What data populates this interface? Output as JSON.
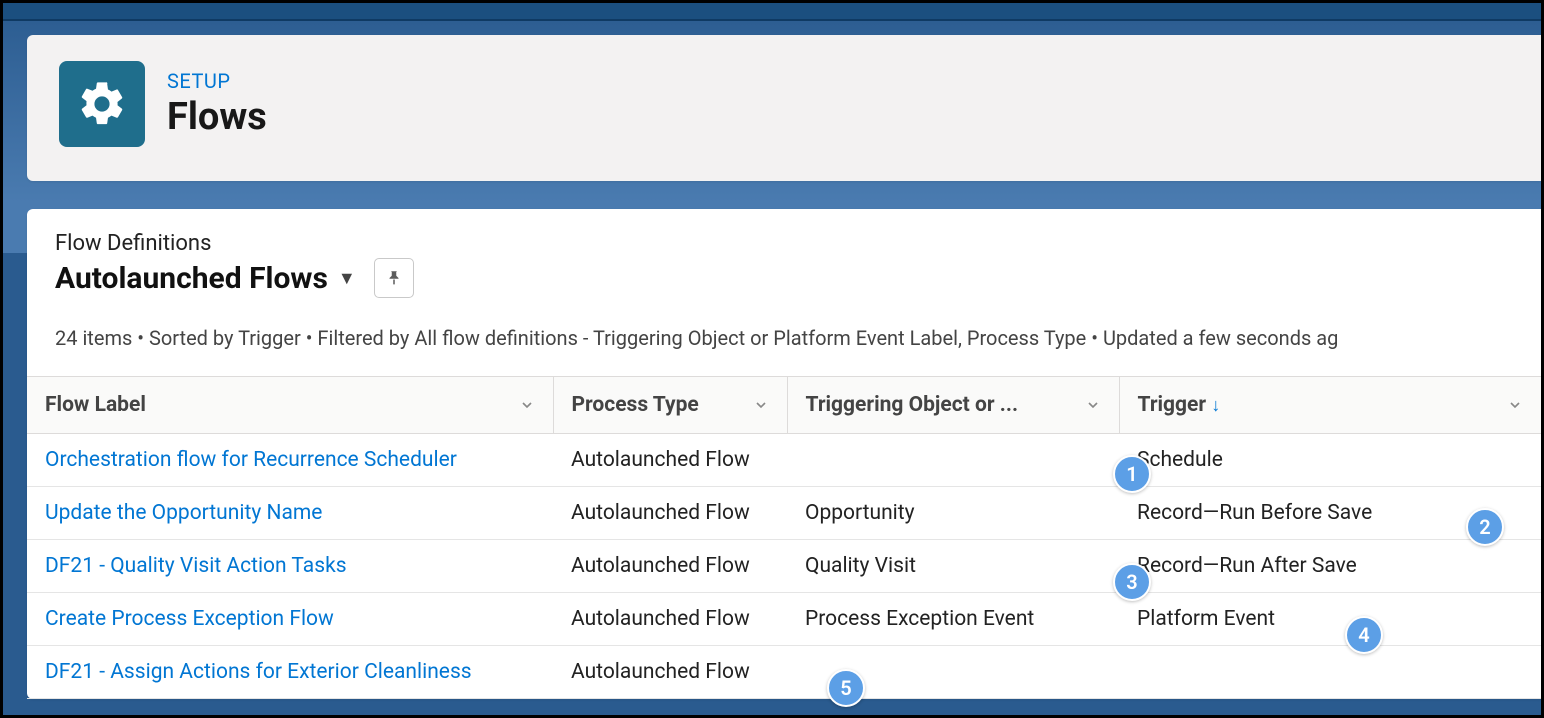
{
  "header": {
    "eyebrow": "SETUP",
    "title": "Flows"
  },
  "list": {
    "object_label": "Flow Definitions",
    "view_name": "Autolaunched Flows",
    "meta": "24 items • Sorted by Trigger • Filtered by All flow definitions - Triggering Object or Platform Event Label, Process Type • Updated a few seconds ag"
  },
  "columns": {
    "label": "Flow Label",
    "process_type": "Process Type",
    "triggering_object": "Triggering Object or ...",
    "trigger": "Trigger"
  },
  "rows": [
    {
      "label": "Orchestration flow for Recurrence Scheduler",
      "process_type": "Autolaunched Flow",
      "triggering_object": "",
      "trigger": "Schedule"
    },
    {
      "label": "Update the Opportunity Name",
      "process_type": "Autolaunched Flow",
      "triggering_object": "Opportunity",
      "trigger": "Record—Run Before Save"
    },
    {
      "label": "DF21 - Quality Visit Action Tasks",
      "process_type": "Autolaunched Flow",
      "triggering_object": "Quality Visit",
      "trigger": "Record—Run After Save"
    },
    {
      "label": "Create Process Exception Flow",
      "process_type": "Autolaunched Flow",
      "triggering_object": "Process Exception Event",
      "trigger": "Platform Event"
    },
    {
      "label": "DF21 - Assign Actions for Exterior Cleanliness",
      "process_type": "Autolaunched Flow",
      "triggering_object": "",
      "trigger": ""
    }
  ],
  "callouts": [
    "1",
    "2",
    "3",
    "4",
    "5"
  ]
}
